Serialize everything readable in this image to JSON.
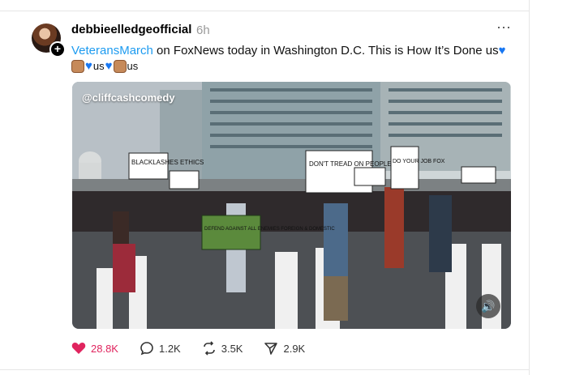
{
  "post": {
    "username": "debbieelledgeofficial",
    "time": "6h",
    "more_icon": "⋯",
    "caption_link": "VeteransMarch",
    "caption_text": " on FoxNews today in Washington D.C. This is How It’s Done us",
    "emoji_line_labels": [
      "us",
      "us"
    ]
  },
  "video": {
    "watermark": "@cliffcashcomedy",
    "signs": [
      "BLACKLASHES ETHICS",
      "DON'T TREAD ON PEOPLE",
      "DO YOUR JOB FOX",
      "DEFEND AGAINST ALL ENEMIES FOREIGN & DOMESTIC"
    ],
    "mute_icon": "speaker-icon"
  },
  "actions": {
    "likes": "28.8K",
    "comments": "1.2K",
    "reposts": "3.5K",
    "shares": "2.9K"
  },
  "colors": {
    "link": "#1d9bf0",
    "like": "#e0245e",
    "heart_emoji": "#1877f2"
  }
}
